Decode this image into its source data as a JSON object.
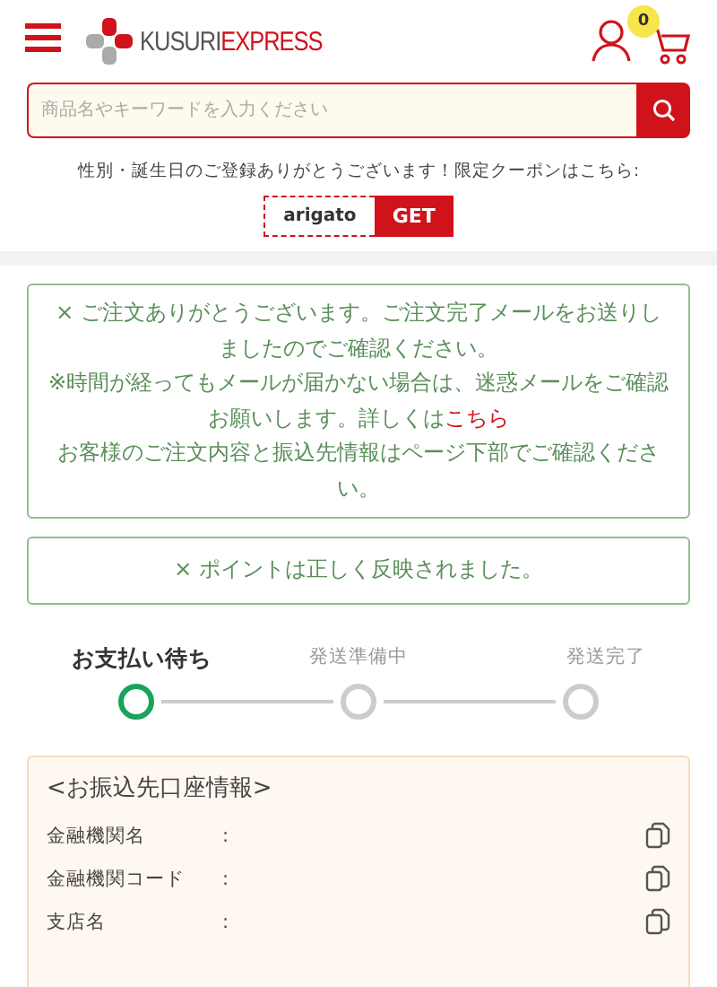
{
  "header": {
    "logo": {
      "first": "KUSURI",
      "second": "EXPRESS"
    },
    "cart_count": "0"
  },
  "search": {
    "placeholder": "商品名やキーワードを入力ください"
  },
  "coupon": {
    "message": "性別・誕生日のご登録ありがとうございます！限定クーポンはこちら:",
    "code": "arigato",
    "button": "GET"
  },
  "notices": [
    {
      "paragraphs": [
        {
          "text": "× ご注文ありがとうございます。ご注文完了メールをお送りしましたのでご確認ください。"
        },
        {
          "text": "※時間が経ってもメールが届かない場合は、迷惑メールをご確認お願いします。詳しくは",
          "link": "こちら"
        },
        {
          "text": "お客様のご注文内容と振込先情報はページ下部でご確認ください。"
        }
      ]
    },
    {
      "paragraphs": [
        {
          "text": "× ポイントは正しく反映されました。"
        }
      ]
    }
  ],
  "steps": [
    {
      "label": "お支払い待ち",
      "selected": true
    },
    {
      "label": "発送準備中",
      "selected": false
    },
    {
      "label": "発送完了",
      "selected": false
    }
  ],
  "bank": {
    "title": "<お振込先口座情報>",
    "rows": [
      {
        "label": "金融機関名",
        "separator": ":"
      },
      {
        "label": "金融機関コード",
        "separator": ":"
      },
      {
        "label": "支店名",
        "separator": ":"
      }
    ]
  }
}
